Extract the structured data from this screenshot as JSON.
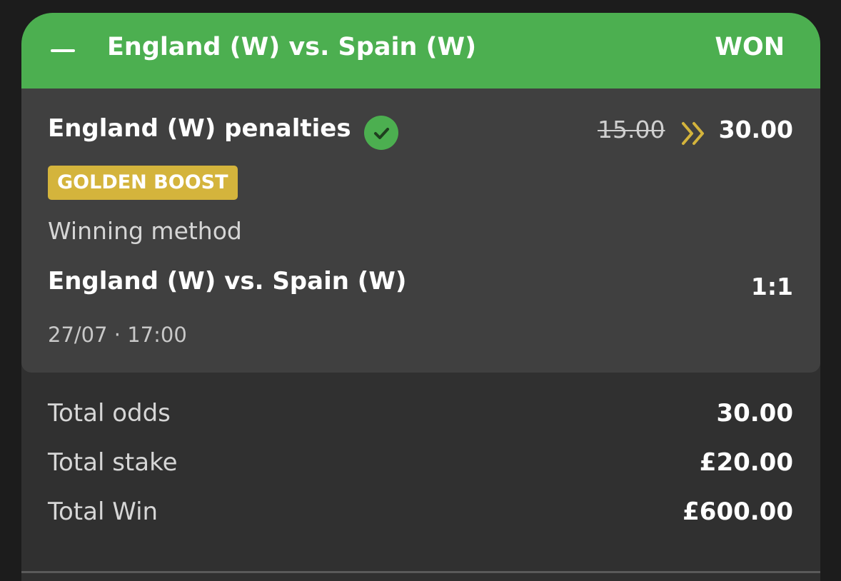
{
  "header": {
    "collapse_icon": "minus-icon",
    "title": "England (W) vs. Spain (W)",
    "status": "WON",
    "color": "#4caf50"
  },
  "selection": {
    "market": "England (W) penalties",
    "result_icon": "check-circle-icon",
    "old_odds": "15.00",
    "boost_icon": "double-chevron-right-icon",
    "new_odds": "30.00",
    "badge": "GOLDEN BOOST",
    "badge_color": "#d4b43c",
    "method_label": "Winning method",
    "event": "England (W) vs. Spain (W)",
    "score": "1:1",
    "datetime": "27/07 · 17:00"
  },
  "summary": {
    "rows": [
      {
        "label": "Total odds",
        "value": "30.00"
      },
      {
        "label": "Total stake",
        "value": "£20.00"
      },
      {
        "label": "Total Win",
        "value": "£600.00"
      }
    ]
  }
}
